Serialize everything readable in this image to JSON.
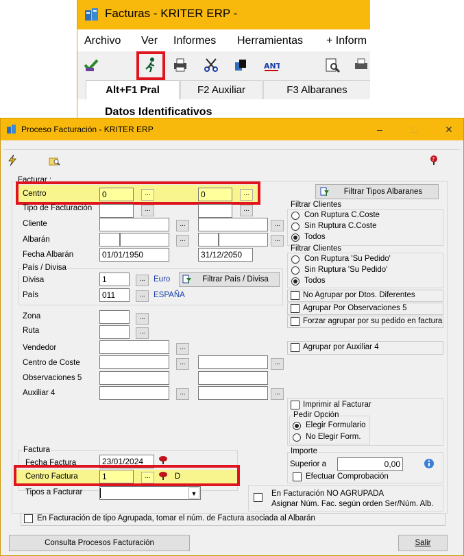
{
  "bg_window": {
    "title": "Facturas - KRITER ERP -",
    "menu": [
      "Archivo",
      "Ver",
      "Informes",
      "Herramientas",
      "+ Inform"
    ],
    "toolbar_icons": [
      "check-icon",
      "runner-icon",
      "printer-icon",
      "scissors-icon",
      "copy-icon",
      "ant-icon",
      "preview-icon",
      "print-icon"
    ],
    "tabs": [
      "Alt+F1 Pral",
      "F2 Auxiliar",
      "F3 Albaranes"
    ],
    "section": "Datos Identificativos"
  },
  "dialog": {
    "title": "Proceso Facturación - KRITER ERP",
    "window_buttons": [
      "–",
      "□",
      "✕"
    ],
    "facturar_group": "Facturar :",
    "centro": {
      "label": "Centro",
      "from": "0",
      "to": "0"
    },
    "tipo_facturacion": {
      "label": "Tipo de Facturación"
    },
    "cliente": {
      "label": "Cliente"
    },
    "albaran": {
      "label": "Albarán"
    },
    "fecha_albaran": {
      "label": "Fecha Albarán",
      "from": "01/01/1950",
      "to": "31/12/2050"
    },
    "pais_divisa_group": "País / Divisa",
    "divisa": {
      "label": "Divisa",
      "value": "1",
      "name": "Euro"
    },
    "pais": {
      "label": "País",
      "value": "011",
      "name": "ESPAÑA"
    },
    "filtrar_pais_btn": "Filtrar País / Divisa",
    "zona": {
      "label": "Zona"
    },
    "ruta": {
      "label": "Ruta"
    },
    "vendedor": {
      "label": "Vendedor"
    },
    "centro_coste": {
      "label": "Centro de Coste"
    },
    "observaciones5": {
      "label": "Observaciones 5"
    },
    "auxiliar4": {
      "label": "Auxiliar 4"
    },
    "filtrar_tipos_btn": "Filtrar Tipos Albaranes",
    "filtrar_clientes_1": {
      "label": "Filtrar Clientes",
      "options": [
        "Con Ruptura C.Coste",
        "Sin Ruptura C.Coste",
        "Todos"
      ],
      "selected": 2
    },
    "filtrar_clientes_2": {
      "label": "Filtrar Clientes",
      "options": [
        "Con Ruptura 'Su Pedido'",
        "Sin Ruptura 'Su Pedido'",
        "Todos"
      ],
      "selected": 2
    },
    "checks": {
      "no_agrupar": "No Agrupar por Dtos. Diferentes",
      "agrupar_obs5": "Agrupar Por Observaciones 5",
      "forzar_agrupar": "Forzar agrupar por su pedido en factura",
      "agrupar_aux4": "Agrupar por Auxiliar 4",
      "imprimir": "Imprimir al Facturar",
      "efectuar": "Efectuar Comprobación",
      "no_agrupada_1": "En Facturación NO AGRUPADA",
      "no_agrupada_2": "Asignar Núm. Fac. según orden Ser/Núm. Alb.",
      "tipo_agrupada": "En Facturación de tipo Agrupada, tomar el núm. de Factura asociada al Albarán"
    },
    "pedir_opcion": {
      "label": "Pedir Opción",
      "options": [
        "Elegir Formulario",
        "No Elegir Form."
      ],
      "selected": 0
    },
    "importe": {
      "label": "Importe",
      "superior_label": "Superior a",
      "superior_value": "0,00"
    },
    "factura_group": "Factura",
    "fecha_factura": {
      "label": "Fecha Factura",
      "value": "23/01/2024"
    },
    "centro_factura": {
      "label": "Centro Factura",
      "value": "1",
      "suffix": "D"
    },
    "tipos_facturar": {
      "label": "Tipos a Facturar",
      "value": ""
    },
    "dots": "...",
    "consulta_btn": "Consulta Procesos Facturación",
    "salir_btn": "Salir"
  }
}
